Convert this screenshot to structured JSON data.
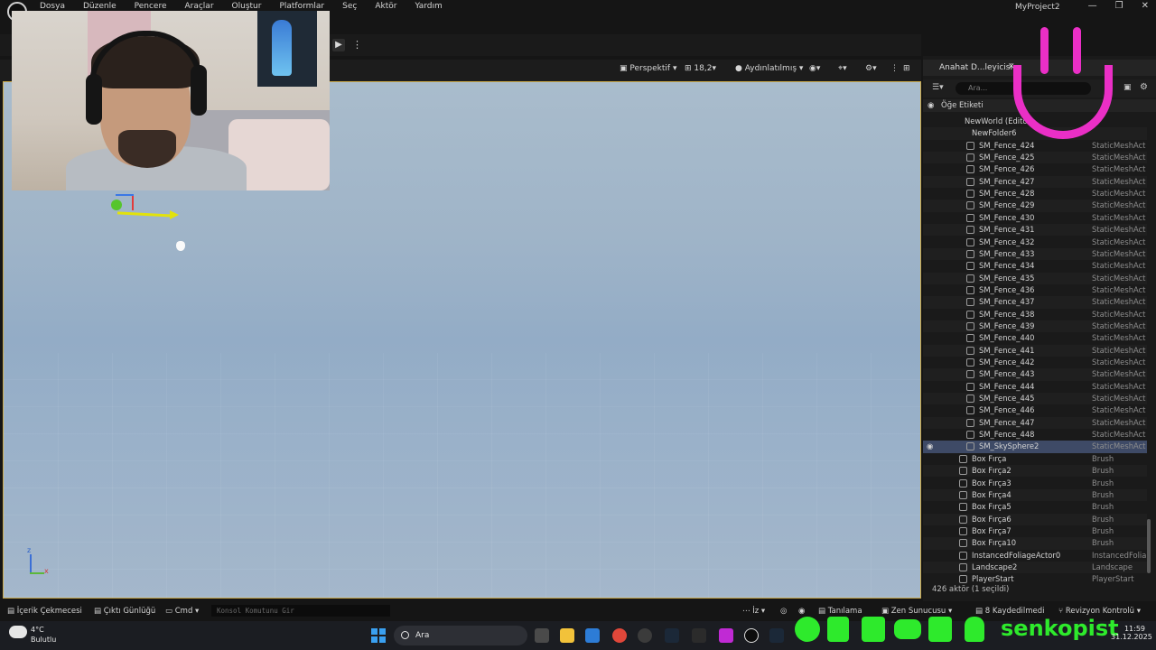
{
  "menubar": {
    "items": [
      "Dosya",
      "Düzenle",
      "Pencere",
      "Araçlar",
      "Oluştur",
      "Platformlar",
      "Seç",
      "Aktör",
      "Yardım"
    ],
    "project_name": "MyProject2",
    "min": "—",
    "max": "❐",
    "close": "✕"
  },
  "viewport_toolbar": {
    "perspective": "Perspektif",
    "fov": "18,2",
    "lit": "Aydınlatılmış"
  },
  "outliner": {
    "tab_title": "Anahat D...leyicisi",
    "search_placeholder": "Ara...",
    "column_label": "Öğe Etiketi",
    "rows": [
      {
        "name": "NewWorld (Editor)",
        "type": ""
      },
      {
        "name": "NewFolder6",
        "type": ""
      },
      {
        "name": "SM_Fence_424",
        "type": "StaticMeshActor"
      },
      {
        "name": "SM_Fence_425",
        "type": "StaticMeshActor"
      },
      {
        "name": "SM_Fence_426",
        "type": "StaticMeshActor"
      },
      {
        "name": "SM_Fence_427",
        "type": "StaticMeshActor"
      },
      {
        "name": "SM_Fence_428",
        "type": "StaticMeshActor"
      },
      {
        "name": "SM_Fence_429",
        "type": "StaticMeshActor"
      },
      {
        "name": "SM_Fence_430",
        "type": "StaticMeshActor"
      },
      {
        "name": "SM_Fence_431",
        "type": "StaticMeshActor"
      },
      {
        "name": "SM_Fence_432",
        "type": "StaticMeshActor"
      },
      {
        "name": "SM_Fence_433",
        "type": "StaticMeshActor"
      },
      {
        "name": "SM_Fence_434",
        "type": "StaticMeshActor"
      },
      {
        "name": "SM_Fence_435",
        "type": "StaticMeshActor"
      },
      {
        "name": "SM_Fence_436",
        "type": "StaticMeshActor"
      },
      {
        "name": "SM_Fence_437",
        "type": "StaticMeshActor"
      },
      {
        "name": "SM_Fence_438",
        "type": "StaticMeshActor"
      },
      {
        "name": "SM_Fence_439",
        "type": "StaticMeshActor"
      },
      {
        "name": "SM_Fence_440",
        "type": "StaticMeshActor"
      },
      {
        "name": "SM_Fence_441",
        "type": "StaticMeshActor"
      },
      {
        "name": "SM_Fence_442",
        "type": "StaticMeshActor"
      },
      {
        "name": "SM_Fence_443",
        "type": "StaticMeshActor"
      },
      {
        "name": "SM_Fence_444",
        "type": "StaticMeshActor"
      },
      {
        "name": "SM_Fence_445",
        "type": "StaticMeshActor"
      },
      {
        "name": "SM_Fence_446",
        "type": "StaticMeshActor"
      },
      {
        "name": "SM_Fence_447",
        "type": "StaticMeshActor"
      },
      {
        "name": "SM_Fence_448",
        "type": "StaticMeshActor"
      },
      {
        "name": "SM_SkySphere2",
        "type": "StaticMeshActor",
        "selected": true
      },
      {
        "name": "Box Fırça",
        "type": "Brush"
      },
      {
        "name": "Box Fırça2",
        "type": "Brush"
      },
      {
        "name": "Box Fırça3",
        "type": "Brush"
      },
      {
        "name": "Box Fırça4",
        "type": "Brush"
      },
      {
        "name": "Box Fırça5",
        "type": "Brush"
      },
      {
        "name": "Box Fırça6",
        "type": "Brush"
      },
      {
        "name": "Box Fırça7",
        "type": "Brush"
      },
      {
        "name": "Box Fırça10",
        "type": "Brush"
      },
      {
        "name": "InstancedFoliageActor0",
        "type": "InstancedFoliageActor"
      },
      {
        "name": "Landscape2",
        "type": "Landscape"
      },
      {
        "name": "PlayerStart",
        "type": "PlayerStart"
      }
    ],
    "count": "426 aktör (1 seçildi)"
  },
  "statusbar": {
    "content_drawer": "İçerik Çekmecesi",
    "output_log": "Çıktı Günlüğü",
    "cmd": "Cmd",
    "console_placeholder": "Konsol Komutunu Gir",
    "trace": "İz",
    "diagnostics": "Tanılama",
    "zen": "Zen Sunucusu",
    "unsaved": "8 Kaydedilmedi",
    "revision": "Revizyon Kontrolü"
  },
  "taskbar": {
    "temp": "4°C",
    "condition": "Bulutlu",
    "search": "Ara",
    "brand": "senkopist",
    "time": "11:59",
    "date": "31.12.2025"
  },
  "colors": {
    "accent_pink": "#ea2fc6",
    "social_green": "#2eea2c",
    "selection": "#3e4a66"
  }
}
